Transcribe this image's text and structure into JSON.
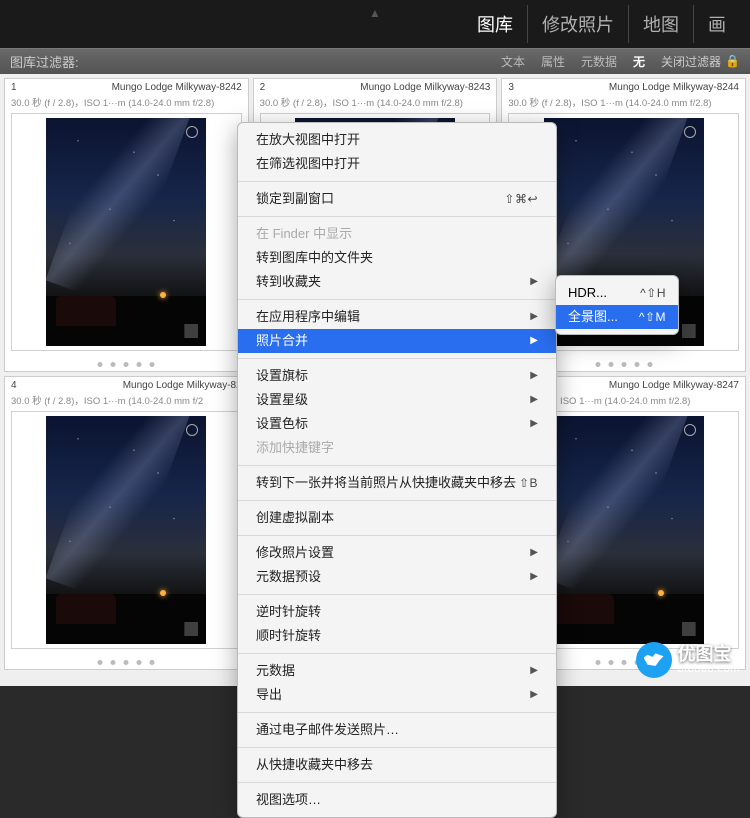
{
  "header": {
    "tabs": [
      "图库",
      "修改照片",
      "地图",
      "画"
    ],
    "active": 0
  },
  "filterbar": {
    "label": "图库过滤器:",
    "pills": [
      "文本",
      "属性",
      "元数据",
      "无"
    ],
    "close": "关闭过滤器"
  },
  "cells": [
    {
      "idx": "1",
      "title": "Mungo Lodge Milkyway-8242",
      "meta": "30.0 秒 (f / 2.8)，ISO 1···m (14.0-24.0 mm f/2.8)"
    },
    {
      "idx": "2",
      "title": "Mungo Lodge Milkyway-8243",
      "meta": "30.0 秒 (f / 2.8)，ISO 1···m (14.0-24.0 mm f/2.8)"
    },
    {
      "idx": "3",
      "title": "Mungo Lodge Milkyway-8244",
      "meta": "30.0 秒 (f / 2.8)，ISO 1···m (14.0-24.0 mm f/2.8)"
    },
    {
      "idx": "4",
      "title": "Mungo Lodge Milkyway-82",
      "meta": "30.0 秒 (f / 2.8)，ISO 1···m (14.0-24.0 mm f/2"
    },
    {
      "idx": "",
      "title": "",
      "meta": ""
    },
    {
      "idx": "",
      "title": "Mungo Lodge Milkyway-8247",
      "meta": "秒 (f / 2.8)，ISO 1···m (14.0-24.0 mm f/2.8)"
    }
  ],
  "ctx": {
    "open_loupe": "在放大视图中打开",
    "open_survey": "在筛选视图中打开",
    "lock_second": "锁定到副窗口",
    "lock_short": "⇧⌘↩",
    "show_finder": "在 Finder 中显示",
    "go_folder": "转到图库中的文件夹",
    "go_collection": "转到收藏夹",
    "edit_in": "在应用程序中编辑",
    "photo_merge": "照片合并",
    "set_flag": "设置旗标",
    "set_rating": "设置星级",
    "set_color": "设置色标",
    "add_keyword": "添加快捷键字",
    "next_remove": "转到下一张并将当前照片从快捷收藏夹中移去",
    "next_remove_short": "⇧B",
    "create_vc": "创建虚拟副本",
    "develop": "修改照片设置",
    "meta_preset": "元数据预设",
    "rotate_ccw": "逆时针旋转",
    "rotate_cw": "顺时针旋转",
    "metadata": "元数据",
    "export": "导出",
    "email": "通过电子邮件发送照片…",
    "remove_quick": "从快捷收藏夹中移去",
    "view_opts": "视图选项…"
  },
  "submenu": {
    "hdr": "HDR...",
    "hdr_short": "^⇧H",
    "pano": "全景图...",
    "pano_short": "^⇧M"
  },
  "watermark": {
    "brand": "优图宝",
    "url": "utobao.com"
  }
}
